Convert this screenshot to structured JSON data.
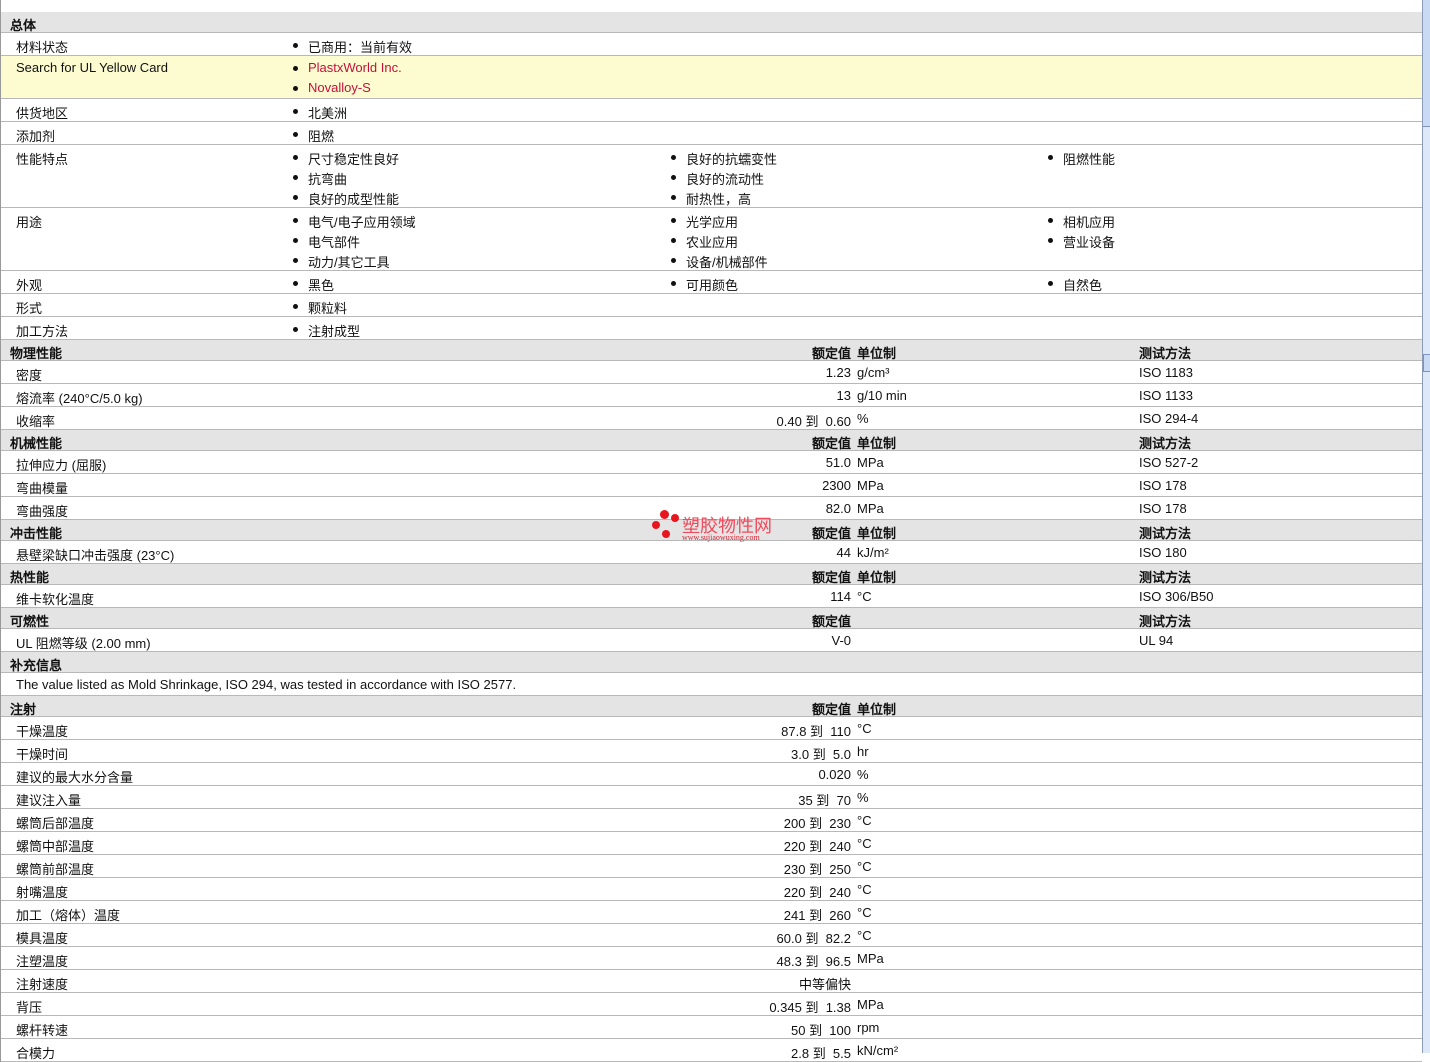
{
  "general": {
    "title": "总体",
    "rows": [
      {
        "label": "材料状态",
        "items": [
          [
            "已商用：当前有效"
          ]
        ]
      },
      {
        "label": "Search for UL Yellow Card",
        "highlight": true,
        "links": true,
        "items": [
          [
            "PlastxWorld Inc.",
            "Novalloy-S"
          ]
        ]
      },
      {
        "label": "供货地区",
        "items": [
          [
            "北美洲"
          ]
        ]
      },
      {
        "label": "添加剂",
        "items": [
          [
            "阻燃"
          ]
        ]
      },
      {
        "label": "性能特点",
        "items": [
          [
            "尺寸稳定性良好",
            "抗弯曲",
            "良好的成型性能"
          ],
          [
            "良好的抗蠕变性",
            "良好的流动性",
            "耐热性，高"
          ],
          [
            "阻燃性能"
          ]
        ]
      },
      {
        "label": "用途",
        "items": [
          [
            "电气/电子应用领域",
            "电气部件",
            "动力/其它工具"
          ],
          [
            "光学应用",
            "农业应用",
            "设备/机械部件"
          ],
          [
            "相机应用",
            "营业设备"
          ]
        ]
      },
      {
        "label": "外观",
        "items": [
          [
            "黑色"
          ],
          [
            "可用颜色"
          ],
          [
            "自然色"
          ]
        ]
      },
      {
        "label": "形式",
        "items": [
          [
            "颗粒料"
          ]
        ]
      },
      {
        "label": "加工方法",
        "items": [
          [
            "注射成型"
          ]
        ]
      }
    ]
  },
  "headers": {
    "value": "额定值",
    "unit": "单位制",
    "test": "测试方法"
  },
  "sections": [
    {
      "title": "物理性能",
      "showUnit": true,
      "showTest": true,
      "rows": [
        {
          "label": "密度",
          "value": "1.23",
          "unit": "g/cm³",
          "test": "ISO 1183"
        },
        {
          "label": "熔流率  (240°C/5.0 kg)",
          "value": "13",
          "unit": "g/10 min",
          "test": "ISO 1133"
        },
        {
          "label": "收缩率",
          "value": "0.40 到  0.60",
          "unit": "%",
          "test": "ISO 294-4"
        }
      ]
    },
    {
      "title": "机械性能",
      "showUnit": true,
      "showTest": true,
      "rows": [
        {
          "label": "拉伸应力  (屈服)",
          "value": "51.0",
          "unit": "MPa",
          "test": "ISO 527-2"
        },
        {
          "label": "弯曲模量",
          "value": "2300",
          "unit": "MPa",
          "test": "ISO 178"
        },
        {
          "label": "弯曲强度",
          "value": "82.0",
          "unit": "MPa",
          "test": "ISO 178"
        }
      ]
    },
    {
      "title": "冲击性能",
      "showUnit": true,
      "showTest": true,
      "rows": [
        {
          "label": "悬壁梁缺口冲击强度  (23°C)",
          "value": "44",
          "unit": "kJ/m²",
          "test": "ISO 180"
        }
      ]
    },
    {
      "title": "热性能",
      "showUnit": true,
      "showTest": true,
      "rows": [
        {
          "label": "维卡软化温度",
          "value": "114",
          "unit": "°C",
          "test": "ISO 306/B50"
        }
      ]
    },
    {
      "title": "可燃性",
      "showUnit": false,
      "showTest": true,
      "rows": [
        {
          "label": "UL 阻燃等级  (2.00 mm)",
          "value": "V-0",
          "unit": "",
          "test": "UL 94"
        }
      ]
    },
    {
      "title": "补充信息",
      "note": "The value listed as Mold Shrinkage, ISO 294, was tested in accordance with ISO 2577."
    },
    {
      "title": "注射",
      "showUnit": true,
      "showTest": false,
      "rows": [
        {
          "label": "干燥温度",
          "value": "87.8 到  110",
          "unit": "°C"
        },
        {
          "label": "干燥时间",
          "value": "3.0 到  5.0",
          "unit": "hr"
        },
        {
          "label": "建议的最大水分含量",
          "value": "0.020",
          "unit": "%"
        },
        {
          "label": "建议注入量",
          "value": "35 到  70",
          "unit": "%"
        },
        {
          "label": "螺筒后部温度",
          "value": "200 到  230",
          "unit": "°C"
        },
        {
          "label": "螺筒中部温度",
          "value": "220 到  240",
          "unit": "°C"
        },
        {
          "label": "螺筒前部温度",
          "value": "230 到  250",
          "unit": "°C"
        },
        {
          "label": "射嘴温度",
          "value": "220 到  240",
          "unit": "°C"
        },
        {
          "label": "加工（熔体）温度",
          "value": "241 到  260",
          "unit": "°C"
        },
        {
          "label": "模具温度",
          "value": "60.0 到  82.2",
          "unit": "°C"
        },
        {
          "label": "注塑温度",
          "value": "48.3 到  96.5",
          "unit": "MPa"
        },
        {
          "label": "注射速度",
          "value": "中等偏快",
          "unit": ""
        },
        {
          "label": "背压",
          "value": "0.345 到  1.38",
          "unit": "MPa"
        },
        {
          "label": "螺杆转速",
          "value": "50 到  100",
          "unit": "rpm"
        },
        {
          "label": "合模力",
          "value": "2.8 到  5.5",
          "unit": "kN/cm²"
        }
      ]
    }
  ],
  "watermark": {
    "text": "塑胶物性网",
    "url": "www.sujiaowuxing.com"
  }
}
